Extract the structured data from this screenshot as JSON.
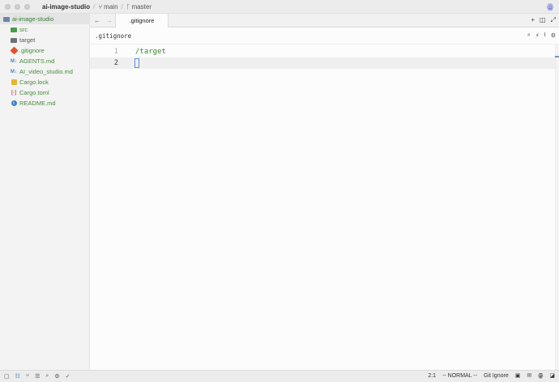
{
  "titlebar": {
    "project": "ai-image-studio",
    "branch_icon_text": "⑂",
    "branch": "main",
    "remote_icon_text": "ᚴ",
    "remote": "master"
  },
  "sidebar": {
    "root": "ai-image-studio",
    "items": [
      {
        "label": "src",
        "icon": "folder-icon"
      },
      {
        "label": "target",
        "icon": "folder-icon"
      },
      {
        "label": ".gitignore",
        "icon": "git-icon"
      },
      {
        "label": "AGENTS.md",
        "icon": "markdown-icon"
      },
      {
        "label": "AI_video_studio.md",
        "icon": "markdown-icon"
      },
      {
        "label": "Cargo.lock",
        "icon": "lock-icon"
      },
      {
        "label": "Cargo.toml",
        "icon": "toml-icon"
      },
      {
        "label": "README.md",
        "icon": "info-icon"
      }
    ]
  },
  "tabs": {
    "active": ".gitignore"
  },
  "breadcrumb": ".gitignore",
  "editor": {
    "lines": [
      {
        "number": "1",
        "text": "/target"
      },
      {
        "number": "2",
        "text": ""
      }
    ]
  },
  "statusbar": {
    "position": "2:1",
    "mode": "-- NORMAL --",
    "language": "Git Ignore"
  },
  "colors": {
    "accent": "#5b8fd9",
    "string_green": "#3b8a2c",
    "git_orange": "#e0502c"
  }
}
